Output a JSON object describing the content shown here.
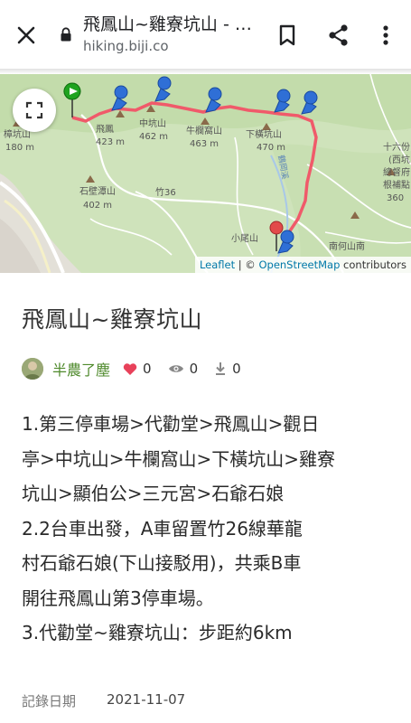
{
  "browser": {
    "page_title": "飛鳳山~雞寮坑山 - 健行筆記",
    "url": "hiking.biji.co",
    "icons": [
      "close-icon",
      "lock-icon",
      "bookmark-icon",
      "share-icon",
      "more-vert-icon"
    ]
  },
  "map": {
    "labels": {
      "feifeng": "飛鳳",
      "feifeng_alt": "423 m",
      "zhongkeng": "中坑山",
      "zhongkeng_alt": "462 m",
      "niulan": "牛欄窩山",
      "niulan_alt": "463 m",
      "xiaheng": "下橫坑山",
      "xiaheng_alt": "470 m",
      "shibi": "石壁潭山",
      "shibi_alt": "402 m",
      "left_peak": "樟坑山",
      "left_alt": "180 m",
      "road": "竹36",
      "xiaoweishan": "小尾山",
      "nanheshan": "南何山南",
      "right1": "十六份",
      "right2": "(西坑",
      "right3": "總督府",
      "right4": "根補點",
      "right5": "360",
      "river": "鶴岡溪"
    },
    "attribution": {
      "leaflet": "Leaflet",
      "sep": " | © ",
      "osm": "OpenStreetMap",
      "contributors": " contributors"
    }
  },
  "article": {
    "title": "飛鳳山~雞寮坑山",
    "author": "半農了塵",
    "likes": "0",
    "views": "0",
    "downloads": "0",
    "lines": [
      "1.第三停車場>代勸堂>飛鳳山>觀日",
      "亭>中坑山>牛欄窩山>下橫坑山>雞寮",
      "坑山>顯伯公>三元宮>石爺石娘",
      "2.2台車出發，A車留置竹26線華龍",
      "村石爺石娘(下山接駁用)，共乘B車",
      "開往飛鳳山第3停車場。",
      "3.代勸堂~雞寮坑山：步距約6km"
    ],
    "record_date_label": "記錄日期",
    "record_date": "2021-11-07"
  },
  "colors": {
    "track": "#f05a6a",
    "author_green": "#4f8a2c",
    "heart": "#e8415a",
    "marker_blue": "#2f6fd6",
    "start_green": "#1fa31f"
  }
}
